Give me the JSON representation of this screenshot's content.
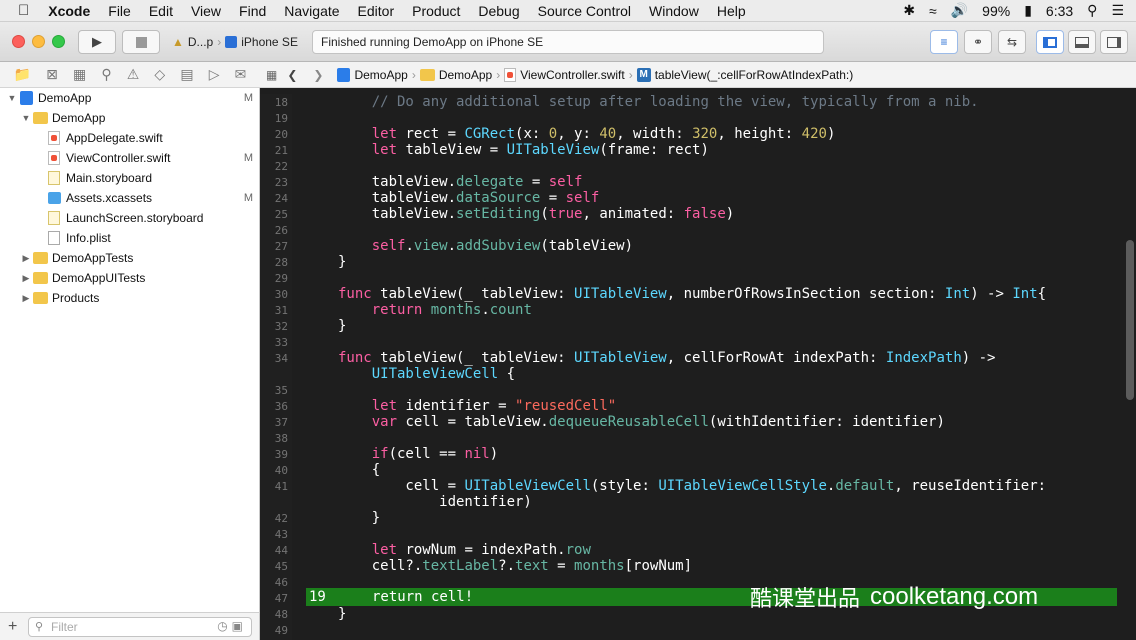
{
  "menubar": {
    "apple_icon": "apple-logo",
    "app_name": "Xcode",
    "items": [
      "File",
      "Edit",
      "View",
      "Find",
      "Navigate",
      "Editor",
      "Product",
      "Debug",
      "Source Control",
      "Window",
      "Help"
    ],
    "battery": "99%",
    "time": "6:33"
  },
  "toolbar": {
    "run_icon": "play-icon",
    "stop_icon": "stop-icon",
    "scheme_app": "D...p",
    "scheme_device": "iPhone SE",
    "status": "Finished running DemoApp on iPhone SE"
  },
  "navigator": {
    "items": [
      {
        "label": "DemoApp",
        "indent": 0,
        "icon": "project",
        "disclosure": "open",
        "badge": "M"
      },
      {
        "label": "DemoApp",
        "indent": 1,
        "icon": "folder",
        "disclosure": "open",
        "badge": ""
      },
      {
        "label": "AppDelegate.swift",
        "indent": 2,
        "icon": "swift",
        "disclosure": "",
        "badge": ""
      },
      {
        "label": "ViewController.swift",
        "indent": 2,
        "icon": "swift",
        "disclosure": "",
        "badge": "M"
      },
      {
        "label": "Main.storyboard",
        "indent": 2,
        "icon": "storyboard",
        "disclosure": "",
        "badge": ""
      },
      {
        "label": "Assets.xcassets",
        "indent": 2,
        "icon": "assets",
        "disclosure": "",
        "badge": "M"
      },
      {
        "label": "LaunchScreen.storyboard",
        "indent": 2,
        "icon": "storyboard",
        "disclosure": "",
        "badge": ""
      },
      {
        "label": "Info.plist",
        "indent": 2,
        "icon": "plist",
        "disclosure": "",
        "badge": ""
      },
      {
        "label": "DemoAppTests",
        "indent": 1,
        "icon": "folder",
        "disclosure": "closed",
        "badge": ""
      },
      {
        "label": "DemoAppUITests",
        "indent": 1,
        "icon": "folder",
        "disclosure": "closed",
        "badge": ""
      },
      {
        "label": "Products",
        "indent": 1,
        "icon": "folder",
        "disclosure": "closed",
        "badge": ""
      }
    ],
    "filter_placeholder": "Filter"
  },
  "jumpbar": {
    "crumbs": [
      "DemoApp",
      "DemoApp",
      "ViewController.swift",
      "tableView(_:cellForRowAtIndexPath:)"
    ]
  },
  "editor": {
    "lines": [
      {
        "n": "18",
        "t": [
          [
            "    ",
            ""
          ],
          [
            "// Do any additional setup after loading the view, typically from a nib.",
            "cm"
          ]
        ]
      },
      {
        "n": "19",
        "t": []
      },
      {
        "n": "20",
        "t": [
          [
            "    ",
            ""
          ],
          [
            "let",
            "kw"
          ],
          [
            " rect = ",
            ""
          ],
          [
            "CGRect",
            "ty"
          ],
          [
            "(x: ",
            ""
          ],
          [
            "0",
            "nm"
          ],
          [
            ", y: ",
            ""
          ],
          [
            "40",
            "nm"
          ],
          [
            ", width: ",
            ""
          ],
          [
            "320",
            "nm"
          ],
          [
            ", height: ",
            ""
          ],
          [
            "420",
            "nm"
          ],
          [
            ")",
            ""
          ]
        ]
      },
      {
        "n": "21",
        "t": [
          [
            "    ",
            ""
          ],
          [
            "let",
            "kw"
          ],
          [
            " tableView = ",
            ""
          ],
          [
            "UITableView",
            "ty"
          ],
          [
            "(frame: rect)",
            ""
          ]
        ]
      },
      {
        "n": "22",
        "t": []
      },
      {
        "n": "23",
        "t": [
          [
            "    tableView.",
            ""
          ],
          [
            "delegate",
            "pr"
          ],
          [
            " = ",
            ""
          ],
          [
            "self",
            "kw"
          ]
        ]
      },
      {
        "n": "24",
        "t": [
          [
            "    tableView.",
            ""
          ],
          [
            "dataSource",
            "pr"
          ],
          [
            " = ",
            ""
          ],
          [
            "self",
            "kw"
          ]
        ]
      },
      {
        "n": "25",
        "t": [
          [
            "    tableView.",
            ""
          ],
          [
            "setEditing",
            "fn"
          ],
          [
            "(",
            ""
          ],
          [
            "true",
            "kw"
          ],
          [
            ", animated: ",
            ""
          ],
          [
            "false",
            "kw"
          ],
          [
            ")",
            ""
          ]
        ]
      },
      {
        "n": "26",
        "t": []
      },
      {
        "n": "27",
        "t": [
          [
            "    ",
            ""
          ],
          [
            "self",
            "kw"
          ],
          [
            ".",
            ""
          ],
          [
            "view",
            "pr"
          ],
          [
            ".",
            ""
          ],
          [
            "addSubview",
            "fn"
          ],
          [
            "(tableView)",
            ""
          ]
        ]
      },
      {
        "n": "28",
        "t": [
          [
            "}",
            ""
          ]
        ]
      },
      {
        "n": "29",
        "t": []
      },
      {
        "n": "30",
        "t": [
          [
            "func",
            "kw"
          ],
          [
            " tableView(_ tableView: ",
            ""
          ],
          [
            "UITableView",
            "ty"
          ],
          [
            ", numberOfRowsInSection section: ",
            ""
          ],
          [
            "Int",
            "ty"
          ],
          [
            ") -> ",
            ""
          ],
          [
            "Int",
            "ty"
          ],
          [
            "{",
            ""
          ]
        ]
      },
      {
        "n": "31",
        "t": [
          [
            "    ",
            ""
          ],
          [
            "return",
            "kw"
          ],
          [
            " ",
            ""
          ],
          [
            "months",
            "fn"
          ],
          [
            ".",
            ""
          ],
          [
            "count",
            "pr"
          ]
        ]
      },
      {
        "n": "32",
        "t": [
          [
            "}",
            ""
          ]
        ]
      },
      {
        "n": "33",
        "t": []
      },
      {
        "n": "34",
        "t": [
          [
            "func",
            "kw"
          ],
          [
            " tableView(_ tableView: ",
            ""
          ],
          [
            "UITableView",
            "ty"
          ],
          [
            ", cellForRowAt indexPath: ",
            ""
          ],
          [
            "IndexPath",
            "ty"
          ],
          [
            ") ->",
            ""
          ]
        ]
      },
      {
        "n": "",
        "t": [
          [
            "    ",
            ""
          ],
          [
            "UITableViewCell",
            "ty"
          ],
          [
            " {",
            ""
          ]
        ]
      },
      {
        "n": "35",
        "t": []
      },
      {
        "n": "36",
        "t": [
          [
            "    ",
            ""
          ],
          [
            "let",
            "kw"
          ],
          [
            " identifier = ",
            ""
          ],
          [
            "\"reusedCell\"",
            "st"
          ]
        ]
      },
      {
        "n": "37",
        "t": [
          [
            "    ",
            ""
          ],
          [
            "var",
            "kw"
          ],
          [
            " cell = tableView.",
            ""
          ],
          [
            "dequeueReusableCell",
            "fn"
          ],
          [
            "(withIdentifier: identifier)",
            ""
          ]
        ]
      },
      {
        "n": "38",
        "t": []
      },
      {
        "n": "39",
        "t": [
          [
            "    ",
            ""
          ],
          [
            "if",
            "kw"
          ],
          [
            "(cell == ",
            ""
          ],
          [
            "nil",
            "kw"
          ],
          [
            ")",
            ""
          ]
        ]
      },
      {
        "n": "40",
        "t": [
          [
            "    {",
            ""
          ]
        ]
      },
      {
        "n": "41",
        "t": [
          [
            "        cell = ",
            ""
          ],
          [
            "UITableViewCell",
            "ty"
          ],
          [
            "(style: ",
            ""
          ],
          [
            "UITableViewCellStyle",
            "ty"
          ],
          [
            ".",
            ""
          ],
          [
            "default",
            "pr"
          ],
          [
            ", reuseIdentifier:",
            ""
          ]
        ]
      },
      {
        "n": "",
        "t": [
          [
            "            identifier)",
            ""
          ]
        ]
      },
      {
        "n": "42",
        "t": [
          [
            "    }",
            ""
          ]
        ]
      },
      {
        "n": "43",
        "t": []
      },
      {
        "n": "44",
        "t": [
          [
            "    ",
            ""
          ],
          [
            "let",
            "kw"
          ],
          [
            " rowNum = indexPath.",
            ""
          ],
          [
            "row",
            "pr"
          ]
        ]
      },
      {
        "n": "45",
        "t": [
          [
            "    cell?.",
            ""
          ],
          [
            "textLabel",
            "pr"
          ],
          [
            "?.",
            ""
          ],
          [
            "text",
            "pr"
          ],
          [
            " = ",
            ""
          ],
          [
            "months",
            "fn"
          ],
          [
            "[rowNum]",
            ""
          ]
        ]
      },
      {
        "n": "46",
        "t": []
      },
      {
        "n": "47",
        "t": []
      },
      {
        "n": "48",
        "t": [
          [
            "}",
            ""
          ]
        ]
      },
      {
        "n": "49",
        "t": []
      }
    ],
    "highlight_linenum": "19",
    "highlight_code": "return cell!",
    "watermark_cn": "酷课堂出品",
    "watermark_en": "coolketang.com"
  }
}
